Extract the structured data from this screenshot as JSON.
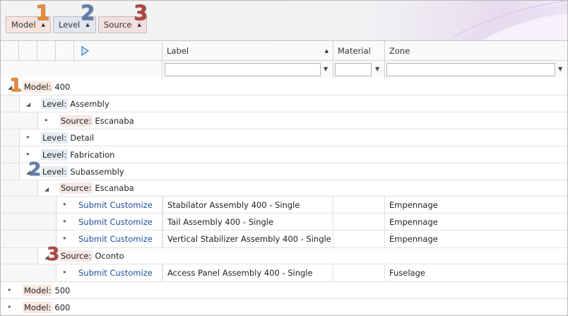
{
  "group_panel": {
    "chips": [
      {
        "label": "Model",
        "badge": "1"
      },
      {
        "label": "Level",
        "badge": "2"
      },
      {
        "label": "Source",
        "badge": "3"
      }
    ]
  },
  "columns": {
    "label": "Label",
    "material": "Material",
    "zone": "Zone"
  },
  "groups": {
    "model_400": {
      "caption": "Model:",
      "value": "400",
      "badge": "1"
    },
    "assembly": {
      "caption": "Level:",
      "value": "Assembly"
    },
    "assembly_escanaba": {
      "caption": "Source:",
      "value": "Escanaba"
    },
    "detail": {
      "caption": "Level:",
      "value": "Detail"
    },
    "fabrication": {
      "caption": "Level:",
      "value": "Fabrication"
    },
    "subassembly": {
      "caption": "Level:",
      "value": "Subassembly",
      "badge": "2"
    },
    "sub_escanaba": {
      "caption": "Source:",
      "value": "Escanaba"
    },
    "sub_oconto": {
      "caption": "Source:",
      "value": "Oconto",
      "badge": "3"
    },
    "model_500": {
      "caption": "Model:",
      "value": "500"
    },
    "model_600": {
      "caption": "Model:",
      "value": "600"
    }
  },
  "rows": [
    {
      "action": "Submit Customize",
      "label": "Stabilator Assembly 400 - Single",
      "material": "",
      "zone": "Empennage"
    },
    {
      "action": "Submit Customize",
      "label": "Tail Assembly 400 - Single",
      "material": "",
      "zone": "Empennage"
    },
    {
      "action": "Submit Customize",
      "label": "Vertical Stabilizer Assembly 400 - Single",
      "material": "",
      "zone": "Empennage"
    },
    {
      "action": "Submit Customize",
      "label": "Access Panel Assembly 400 - Single",
      "material": "",
      "zone": "Fuselage"
    }
  ],
  "colors": {
    "accent_orange": "#ef8a2e",
    "accent_blue": "#5f7fae",
    "accent_red": "#b4443f",
    "link": "#1e4e9c"
  }
}
